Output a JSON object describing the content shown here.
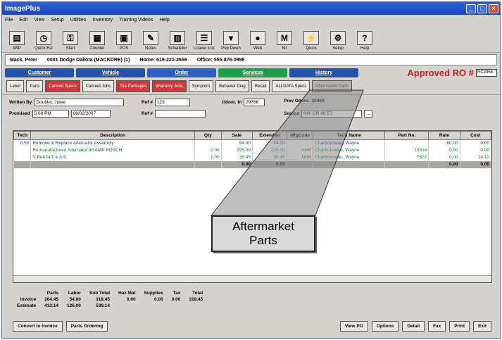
{
  "window": {
    "title": "ImagePlus"
  },
  "menu": [
    "File",
    "Edit",
    "View",
    "Setup",
    "Utilities",
    "Inventory",
    "Training Videos",
    "Help"
  ],
  "toolbar": [
    {
      "label": "WIP",
      "icon": "document-icon"
    },
    {
      "label": "Quick Est",
      "icon": "clock-icon"
    },
    {
      "label": "Start",
      "icon": "key-icon"
    },
    {
      "label": "Counter",
      "icon": "register-icon"
    },
    {
      "label": "POS",
      "icon": "pos-icon"
    },
    {
      "label": "Notes",
      "icon": "notes-icon"
    },
    {
      "label": "Scheduler",
      "icon": "scheduler-icon"
    },
    {
      "label": "Loaner List",
      "icon": "car-list-icon"
    },
    {
      "label": "Pop Down",
      "icon": "popdown-icon"
    },
    {
      "label": "Web",
      "icon": "globe-icon"
    },
    {
      "label": "MI",
      "icon": "mi-icon"
    },
    {
      "label": "Quick",
      "icon": "quick-icon"
    },
    {
      "label": "Setup",
      "icon": "gears-icon"
    },
    {
      "label": "Help",
      "icon": "help-icon"
    }
  ],
  "infobar": {
    "customer": "Mack, Peter",
    "vehicle": "0001 Dodge Dakota (MACKDRE) (1)",
    "home": "Home: 619-221-2656",
    "office": "Office: 555-876-0998"
  },
  "tabs": [
    {
      "label": "Customer",
      "color": "#2253a8"
    },
    {
      "label": "Vehicle",
      "color": "#2253a8"
    },
    {
      "label": "Order",
      "color": "#2d5fc2"
    },
    {
      "label": "Services",
      "color": "#1ea04a"
    },
    {
      "label": "History",
      "color": "#2253a8"
    }
  ],
  "ro": {
    "label": "Approved RO #",
    "number": "RC2956"
  },
  "actions": [
    {
      "label": "Labor",
      "style": ""
    },
    {
      "label": "Parts",
      "style": ""
    },
    {
      "label": "Canned Specs",
      "style": "red"
    },
    {
      "label": "Canned Jobs",
      "style": ""
    },
    {
      "label": "Tire Packages",
      "style": "red"
    },
    {
      "label": "Warranty Jobs",
      "style": "red"
    },
    {
      "label": "Symptom",
      "style": ""
    },
    {
      "label": "Behavior Diag",
      "style": ""
    },
    {
      "label": "Recall",
      "style": ""
    },
    {
      "label": "ALLDATA Specs",
      "style": ""
    },
    {
      "label": "Aftermarket Parts",
      "style": "dim"
    }
  ],
  "fields": {
    "written_by_label": "Written By",
    "written_by": "Doublet, Julee",
    "ref1_label": "Ref #",
    "ref1": "123",
    "promised_label": "Promised",
    "promised_time": "5:00 PM",
    "promised_date": "08/02/2007",
    "ref2_label": "Ref #",
    "ref2": "",
    "odom_label": "Odom. In",
    "odom": "29786",
    "prev_odom_label": "Prev Odom.",
    "prev_odom": "30450",
    "source_label": "Source",
    "source": "NH: CR 48 E7"
  },
  "grid": {
    "columns": [
      "Tech",
      "Description",
      "Qty",
      "Sale",
      "Extended",
      "MfgCode",
      "Tech Name",
      "Part No.",
      "Rate",
      "Cost"
    ],
    "rows": [
      [
        "0.90",
        "Remove & Replace Alternator Assembly",
        "",
        "54.00",
        "54.00",
        "",
        "Charbonneau, Wayne",
        "",
        "60.00",
        "0.00"
      ],
      [
        "",
        "Remanufactured Alternator 90 AMP BOSCH",
        "1.00",
        "225.00",
        "225.00",
        "AMP",
        "Charbonneau, Wayne",
        "13314",
        "0.00",
        "0.00"
      ],
      [
        "",
        "V-Belt ALT & A/C",
        "1.00",
        "35.45",
        "35.45",
        "DAN",
        "Charbonneau, Wayne",
        "7612",
        "0.00",
        "14.10"
      ]
    ],
    "total_row": [
      "",
      "",
      "",
      "0.00",
      "0.00",
      "",
      "",
      "",
      "0.00",
      "0.00"
    ]
  },
  "totals": {
    "headers": [
      "",
      "Parts",
      "Labor",
      "Sub Total",
      "Haz Mat",
      "Supplies",
      "Tax",
      "Total"
    ],
    "rows": [
      [
        "Invoice",
        "264.45",
        "54.00",
        "318.45",
        "0.00",
        "0.00",
        "0.00",
        "318.45"
      ],
      [
        "Estimate",
        "413.14",
        "126.00",
        "539.14",
        "",
        "",
        "",
        ""
      ]
    ]
  },
  "bottom_left": [
    "Convert to Invoice",
    "Parts Ordering"
  ],
  "bottom_right": [
    "View PO",
    "Options",
    "Detail",
    "Fax",
    "Print",
    "Exit"
  ],
  "callout": {
    "line1": "Aftermarket",
    "line2": "Parts"
  }
}
